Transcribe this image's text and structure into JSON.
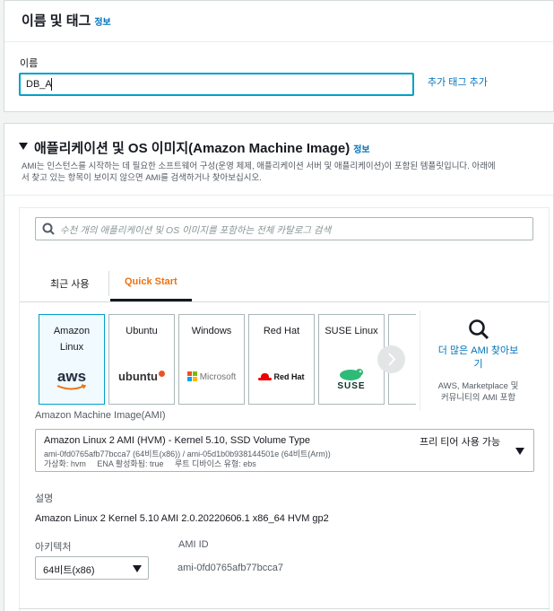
{
  "name_section": {
    "title": "이름 및 태그",
    "info": "정보",
    "name_label": "이름",
    "name_value": "DB_A",
    "add_tag": "추가 태그 추가"
  },
  "ami_section": {
    "title": "애플리케이션 및 OS 이미지(Amazon Machine Image)",
    "info": "정보",
    "desc_line1": "AMI는 인스턴스를 시작하는 데 필요한 소프트웨어 구성(운영 체제, 애플리케이션 서버 및 애플리케이션)이 포함된 템플릿입니다. 아래에",
    "desc_line2": "서 찾고 있는 항목이 보이지 않으면 AMI를 검색하거나 찾아보십시오.",
    "search_placeholder": "수천 개의 애플리케이션 및 OS 이미지를 포함하는 전체 카탈로그 검색",
    "tabs": {
      "recent": "최근 사용",
      "quick_start": "Quick Start"
    },
    "tiles": [
      {
        "name_line1": "Amazon",
        "name_line2": "Linux",
        "logo": "aws"
      },
      {
        "name_line1": "Ubuntu",
        "name_line2": "",
        "logo": "ubuntu"
      },
      {
        "name_line1": "Windows",
        "name_line2": "",
        "logo": "Microsoft"
      },
      {
        "name_line1": "Red Hat",
        "name_line2": "",
        "logo": "Red Hat"
      },
      {
        "name_line1": "SUSE Linux",
        "name_line2": "",
        "logo": "SUSE"
      }
    ],
    "browse_more_line1": "더 많은 AMI 찾아보",
    "browse_more_line2": "기",
    "browse_sub_line1": "AWS, Marketplace 및",
    "browse_sub_line2": "커뮤니티의 AMI 포함",
    "ami_label": "Amazon Machine Image(AMI)",
    "selected_ami": {
      "name": "Amazon Linux 2 AMI (HVM) - Kernel 5.10, SSD Volume Type",
      "ids": "ami-0fd0765afb77bcca7 (64비트(x86)) / ami-05d1b0b938144501e (64비트(Arm))",
      "meta": "가상화: hvm     ENA 활성화됨: true     루트 디바이스 유형: ebs",
      "free_tier": "프리 티어 사용 가능"
    },
    "description_label": "설명",
    "description_value": "Amazon Linux 2 Kernel 5.10 AMI 2.0.20220606.1 x86_64 HVM gp2",
    "arch_label": "아키텍처",
    "arch_value": "64비트(x86)",
    "ami_id_label": "AMI ID",
    "ami_id_value": "ami-0fd0765afb77bcca7"
  },
  "colors": {
    "accent_orange": "#ec7211",
    "link_blue": "#0073bb",
    "selected_border": "#00a1c9",
    "input_focus": "#00a1c9"
  }
}
